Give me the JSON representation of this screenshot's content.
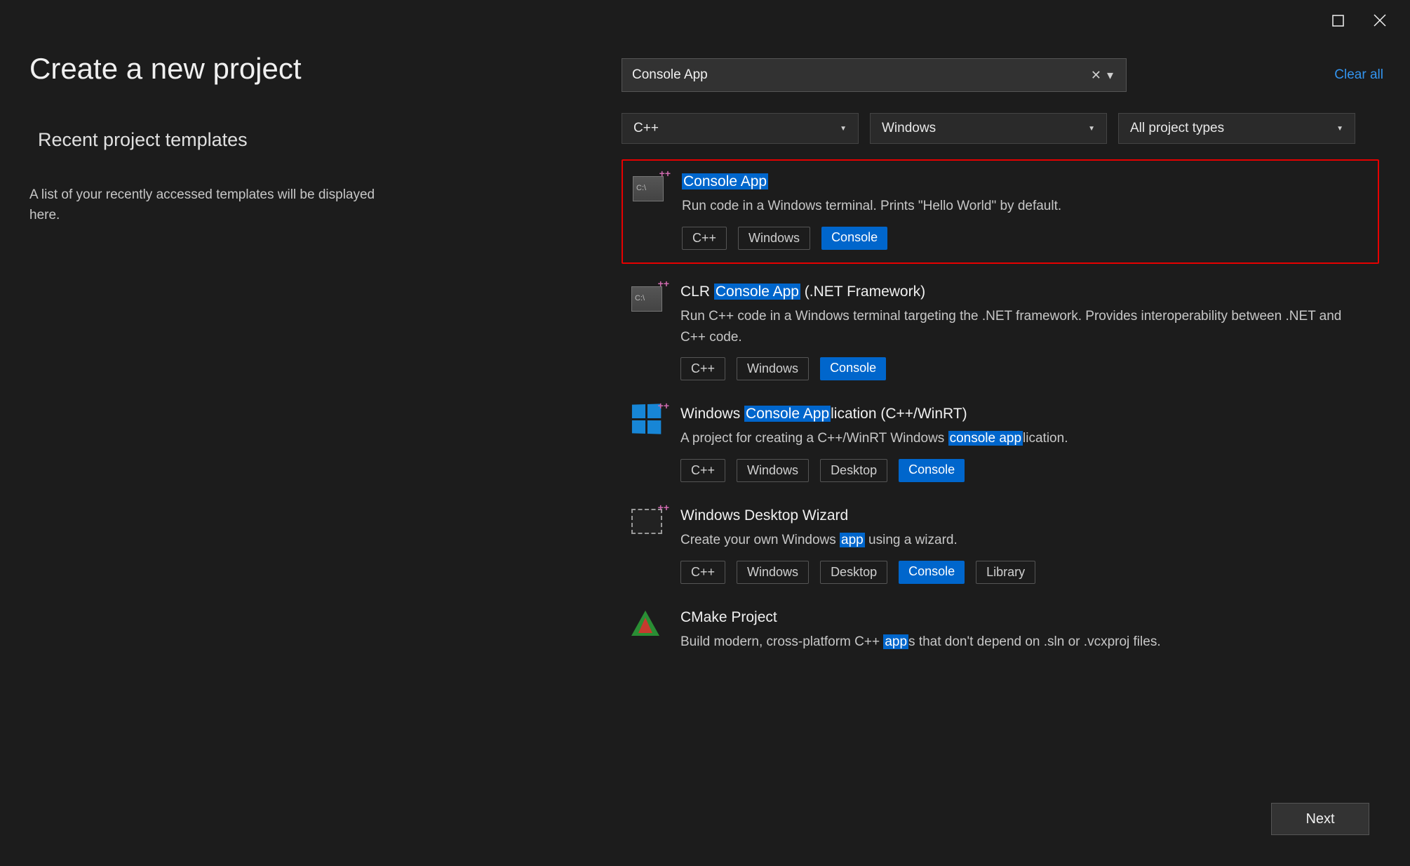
{
  "page_title": "Create a new project",
  "recent_heading": "Recent project templates",
  "recent_description": "A list of your recently accessed templates will be displayed here.",
  "search_value": "Console App",
  "clear_all_label": "Clear all",
  "filters": {
    "language": "C++",
    "platform": "Windows",
    "project_type": "All project types"
  },
  "templates": [
    {
      "id": "console-app",
      "icon": "console",
      "title_parts": [
        {
          "text": "Console App",
          "hl": true
        }
      ],
      "description_parts": [
        {
          "text": "Run code in a Windows terminal. Prints \"Hello World\" by default.",
          "hl": false
        }
      ],
      "tags": [
        {
          "label": "C++",
          "hl": false
        },
        {
          "label": "Windows",
          "hl": false
        },
        {
          "label": "Console",
          "hl": true
        }
      ],
      "selected": true
    },
    {
      "id": "clr-console-app",
      "icon": "console",
      "title_parts": [
        {
          "text": "CLR ",
          "hl": false
        },
        {
          "text": "Console App",
          "hl": true
        },
        {
          "text": " (.NET Framework)",
          "hl": false
        }
      ],
      "description_parts": [
        {
          "text": "Run C++ code in a Windows terminal targeting the .NET framework. Provides interoperability between .NET and C++ code.",
          "hl": false
        }
      ],
      "tags": [
        {
          "label": "C++",
          "hl": false
        },
        {
          "label": "Windows",
          "hl": false
        },
        {
          "label": "Console",
          "hl": true
        }
      ],
      "selected": false
    },
    {
      "id": "winrt-console-app",
      "icon": "windows",
      "title_parts": [
        {
          "text": "Windows ",
          "hl": false
        },
        {
          "text": "Console App",
          "hl": true
        },
        {
          "text": "lication (C++/WinRT)",
          "hl": false
        }
      ],
      "description_parts": [
        {
          "text": "A project for creating a C++/WinRT Windows ",
          "hl": false
        },
        {
          "text": "console app",
          "hl": true
        },
        {
          "text": "lication.",
          "hl": false
        }
      ],
      "tags": [
        {
          "label": "C++",
          "hl": false
        },
        {
          "label": "Windows",
          "hl": false
        },
        {
          "label": "Desktop",
          "hl": false
        },
        {
          "label": "Console",
          "hl": true
        }
      ],
      "selected": false
    },
    {
      "id": "windows-desktop-wizard",
      "icon": "wizard",
      "title_parts": [
        {
          "text": "Windows Desktop Wizard",
          "hl": false
        }
      ],
      "description_parts": [
        {
          "text": "Create your own Windows ",
          "hl": false
        },
        {
          "text": "app",
          "hl": true
        },
        {
          "text": " using a wizard.",
          "hl": false
        }
      ],
      "tags": [
        {
          "label": "C++",
          "hl": false
        },
        {
          "label": "Windows",
          "hl": false
        },
        {
          "label": "Desktop",
          "hl": false
        },
        {
          "label": "Console",
          "hl": true
        },
        {
          "label": "Library",
          "hl": false
        }
      ],
      "selected": false
    },
    {
      "id": "cmake-project",
      "icon": "cmake",
      "title_parts": [
        {
          "text": "CMake Project",
          "hl": false
        }
      ],
      "description_parts": [
        {
          "text": "Build modern, cross-platform C++ ",
          "hl": false
        },
        {
          "text": "app",
          "hl": true
        },
        {
          "text": "s that don't depend on .sln or .vcxproj files.",
          "hl": false
        }
      ],
      "tags": [],
      "selected": false
    }
  ],
  "next_button": "Next"
}
